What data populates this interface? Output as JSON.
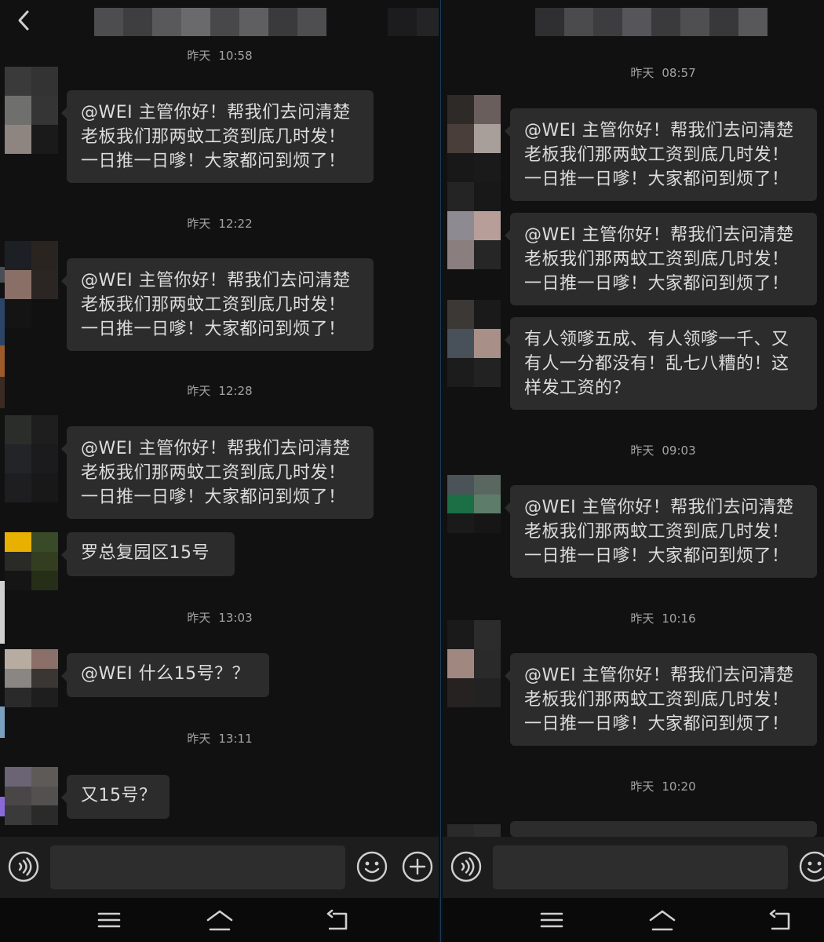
{
  "colors": {
    "background": "#111112",
    "bubble": "#2c2c2c",
    "bubble_text": "#dcdcdc",
    "timestamp_text": "#a3a3a3",
    "input_bar": "#1d1d1e",
    "nav_bar": "#0a0a0a"
  },
  "icons": {
    "back": "chevron-left-icon",
    "voice": "voice-icon",
    "emoji": "emoji-icon",
    "add": "plus-icon",
    "menu": "menu-icon",
    "home": "home-icon",
    "return": "back-icon"
  },
  "left": {
    "messages": [
      {
        "date": "昨天",
        "time": "10:58",
        "lines": [
          "@WEI 主管你好！帮我们去问清楚",
          "老板我们那两蚊工资到底几时发！",
          "一日推一日嗲！大家都问到烦了！"
        ]
      },
      {
        "date": "昨天",
        "time": "12:22",
        "lines": [
          "@WEI 主管你好！帮我们去问清楚",
          "老板我们那两蚊工资到底几时发！",
          "一日推一日嗲！大家都问到烦了！"
        ]
      },
      {
        "date": "昨天",
        "time": "12:28",
        "lines": [
          "@WEI 主管你好！帮我们去问清楚",
          "老板我们那两蚊工资到底几时发！",
          "一日推一日嗲！大家都问到烦了！"
        ]
      },
      {
        "lines": [
          "罗总复园区15号"
        ]
      },
      {
        "date": "昨天",
        "time": "13:03",
        "lines": [
          "@WEI 什么15号？？"
        ]
      },
      {
        "date": "昨天",
        "time": "13:11",
        "lines": [
          "又15号？"
        ]
      }
    ]
  },
  "right": {
    "messages": [
      {
        "date": "昨天",
        "time": "08:57",
        "lines": [
          "@WEI 主管你好！帮我们去问清楚",
          "老板我们那两蚊工资到底几时发！",
          "一日推一日嗲！大家都问到烦了！"
        ]
      },
      {
        "lines": [
          "@WEI 主管你好！帮我们去问清楚",
          "老板我们那两蚊工资到底几时发！",
          "一日推一日嗲！大家都问到烦了！"
        ]
      },
      {
        "lines": [
          "有人领嗲五成、有人领嗲一千、又",
          "有人一分都没有！乱七八糟的！这",
          "样发工资的？"
        ]
      },
      {
        "date": "昨天",
        "time": "09:03",
        "lines": [
          "@WEI 主管你好！帮我们去问清楚",
          "老板我们那两蚊工资到底几时发！",
          "一日推一日嗲！大家都问到烦了！"
        ]
      },
      {
        "date": "昨天",
        "time": "10:16",
        "lines": [
          "@WEI 主管你好！帮我们去问清楚",
          "老板我们那两蚊工资到底几时发！",
          "一日推一日嗲！大家都问到烦了！"
        ]
      },
      {
        "date": "昨天",
        "time": "10:20",
        "lines": []
      }
    ]
  }
}
